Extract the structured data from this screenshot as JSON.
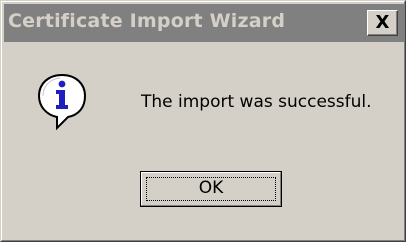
{
  "window": {
    "title": "Certificate Import Wizard"
  },
  "title_bar": {
    "close_icon": "close-icon",
    "close_label": "X"
  },
  "dialog": {
    "icon": "information-icon",
    "message": "The import was successful."
  },
  "buttons": {
    "ok_label": "OK"
  },
  "colors": {
    "face": "#d4d0c8",
    "inactive_titlebar": "#808080",
    "inactive_title_text": "#d4d0c8",
    "info_icon_blue": "#1f1fbf"
  }
}
